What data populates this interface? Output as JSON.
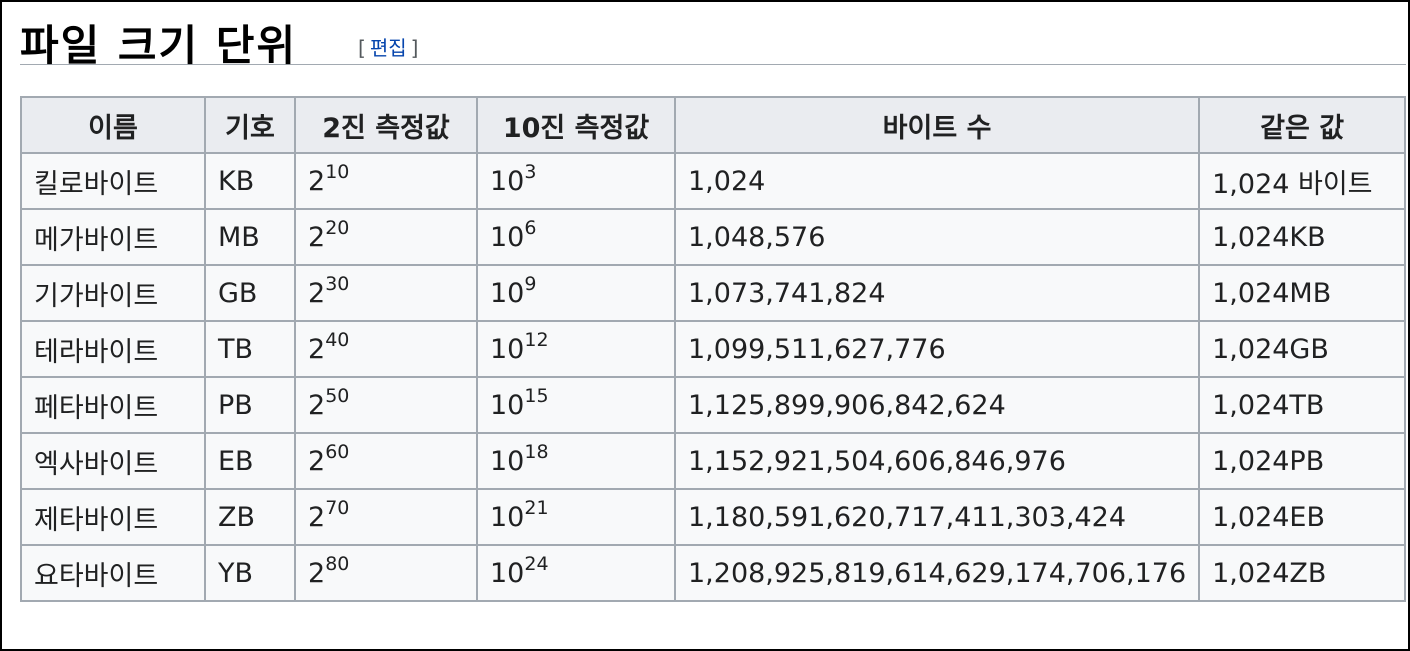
{
  "section": {
    "title": "파일 크기 단위",
    "edit_open": "[",
    "edit_label": "편집",
    "edit_close": "]"
  },
  "table": {
    "headers": [
      "이름",
      "기호",
      "2진 측정값",
      "10진 측정값",
      "바이트 수",
      "같은 값"
    ],
    "rows": [
      {
        "name": "킬로바이트",
        "symbol": "KB",
        "bin_base": "2",
        "bin_exp": "10",
        "dec_base": "10",
        "dec_exp": "3",
        "bytes": "1,024",
        "equal": "1,024 바이트"
      },
      {
        "name": "메가바이트",
        "symbol": "MB",
        "bin_base": "2",
        "bin_exp": "20",
        "dec_base": "10",
        "dec_exp": "6",
        "bytes": "1,048,576",
        "equal": "1,024KB"
      },
      {
        "name": "기가바이트",
        "symbol": "GB",
        "bin_base": "2",
        "bin_exp": "30",
        "dec_base": "10",
        "dec_exp": "9",
        "bytes": "1,073,741,824",
        "equal": "1,024MB"
      },
      {
        "name": "테라바이트",
        "symbol": "TB",
        "bin_base": "2",
        "bin_exp": "40",
        "dec_base": "10",
        "dec_exp": "12",
        "bytes": "1,099,511,627,776",
        "equal": "1,024GB"
      },
      {
        "name": "페타바이트",
        "symbol": "PB",
        "bin_base": "2",
        "bin_exp": "50",
        "dec_base": "10",
        "dec_exp": "15",
        "bytes": "1,125,899,906,842,624",
        "equal": "1,024TB"
      },
      {
        "name": "엑사바이트",
        "symbol": "EB",
        "bin_base": "2",
        "bin_exp": "60",
        "dec_base": "10",
        "dec_exp": "18",
        "bytes": "1,152,921,504,606,846,976",
        "equal": "1,024PB"
      },
      {
        "name": "제타바이트",
        "symbol": "ZB",
        "bin_base": "2",
        "bin_exp": "70",
        "dec_base": "10",
        "dec_exp": "21",
        "bytes": "1,180,591,620,717,411,303,424",
        "equal": "1,024EB"
      },
      {
        "name": "요타바이트",
        "symbol": "YB",
        "bin_base": "2",
        "bin_exp": "80",
        "dec_base": "10",
        "dec_exp": "24",
        "bytes": "1,208,925,819,614,629,174,706,176",
        "equal": "1,024ZB"
      }
    ]
  },
  "colors": {
    "link": "#0645ad",
    "header_bg": "#eaecf0",
    "cell_bg": "#f8f9fa",
    "border": "#a2a9b1"
  }
}
